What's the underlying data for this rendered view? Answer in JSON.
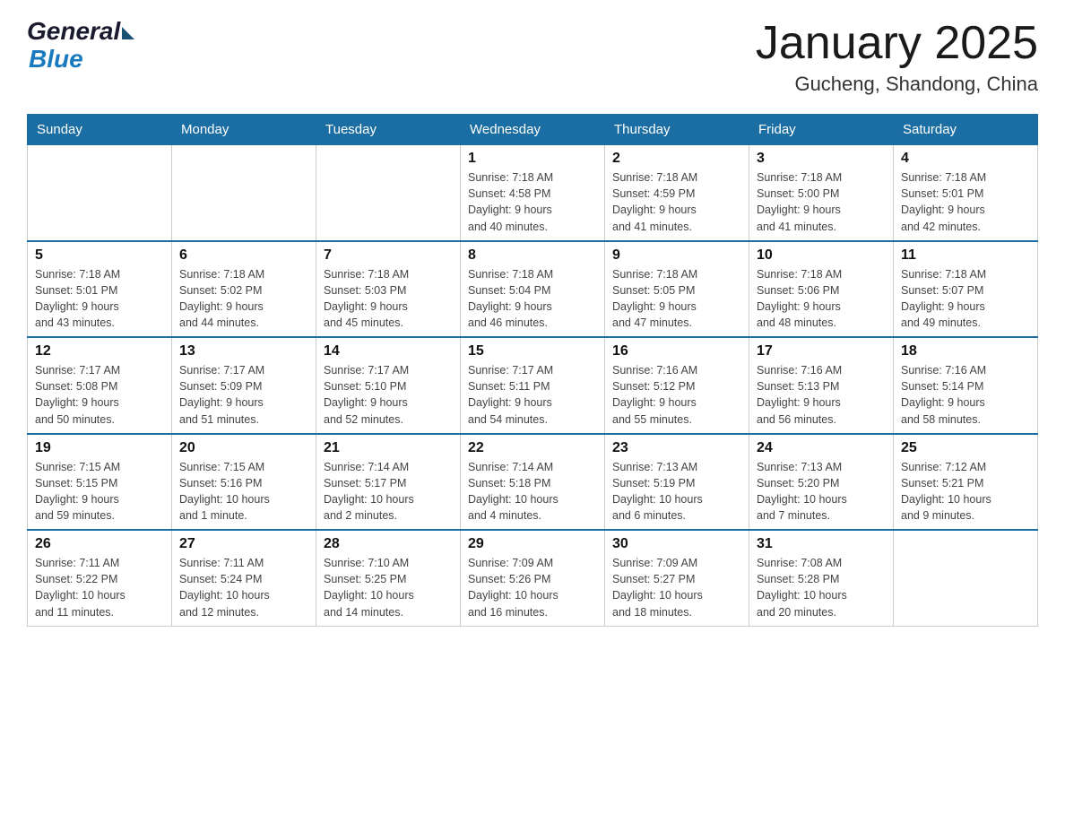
{
  "header": {
    "logo_general": "General",
    "logo_blue": "Blue",
    "month_title": "January 2025",
    "location": "Gucheng, Shandong, China"
  },
  "weekdays": [
    "Sunday",
    "Monday",
    "Tuesday",
    "Wednesday",
    "Thursday",
    "Friday",
    "Saturday"
  ],
  "weeks": [
    [
      {
        "day": "",
        "info": ""
      },
      {
        "day": "",
        "info": ""
      },
      {
        "day": "",
        "info": ""
      },
      {
        "day": "1",
        "info": "Sunrise: 7:18 AM\nSunset: 4:58 PM\nDaylight: 9 hours\nand 40 minutes."
      },
      {
        "day": "2",
        "info": "Sunrise: 7:18 AM\nSunset: 4:59 PM\nDaylight: 9 hours\nand 41 minutes."
      },
      {
        "day": "3",
        "info": "Sunrise: 7:18 AM\nSunset: 5:00 PM\nDaylight: 9 hours\nand 41 minutes."
      },
      {
        "day": "4",
        "info": "Sunrise: 7:18 AM\nSunset: 5:01 PM\nDaylight: 9 hours\nand 42 minutes."
      }
    ],
    [
      {
        "day": "5",
        "info": "Sunrise: 7:18 AM\nSunset: 5:01 PM\nDaylight: 9 hours\nand 43 minutes."
      },
      {
        "day": "6",
        "info": "Sunrise: 7:18 AM\nSunset: 5:02 PM\nDaylight: 9 hours\nand 44 minutes."
      },
      {
        "day": "7",
        "info": "Sunrise: 7:18 AM\nSunset: 5:03 PM\nDaylight: 9 hours\nand 45 minutes."
      },
      {
        "day": "8",
        "info": "Sunrise: 7:18 AM\nSunset: 5:04 PM\nDaylight: 9 hours\nand 46 minutes."
      },
      {
        "day": "9",
        "info": "Sunrise: 7:18 AM\nSunset: 5:05 PM\nDaylight: 9 hours\nand 47 minutes."
      },
      {
        "day": "10",
        "info": "Sunrise: 7:18 AM\nSunset: 5:06 PM\nDaylight: 9 hours\nand 48 minutes."
      },
      {
        "day": "11",
        "info": "Sunrise: 7:18 AM\nSunset: 5:07 PM\nDaylight: 9 hours\nand 49 minutes."
      }
    ],
    [
      {
        "day": "12",
        "info": "Sunrise: 7:17 AM\nSunset: 5:08 PM\nDaylight: 9 hours\nand 50 minutes."
      },
      {
        "day": "13",
        "info": "Sunrise: 7:17 AM\nSunset: 5:09 PM\nDaylight: 9 hours\nand 51 minutes."
      },
      {
        "day": "14",
        "info": "Sunrise: 7:17 AM\nSunset: 5:10 PM\nDaylight: 9 hours\nand 52 minutes."
      },
      {
        "day": "15",
        "info": "Sunrise: 7:17 AM\nSunset: 5:11 PM\nDaylight: 9 hours\nand 54 minutes."
      },
      {
        "day": "16",
        "info": "Sunrise: 7:16 AM\nSunset: 5:12 PM\nDaylight: 9 hours\nand 55 minutes."
      },
      {
        "day": "17",
        "info": "Sunrise: 7:16 AM\nSunset: 5:13 PM\nDaylight: 9 hours\nand 56 minutes."
      },
      {
        "day": "18",
        "info": "Sunrise: 7:16 AM\nSunset: 5:14 PM\nDaylight: 9 hours\nand 58 minutes."
      }
    ],
    [
      {
        "day": "19",
        "info": "Sunrise: 7:15 AM\nSunset: 5:15 PM\nDaylight: 9 hours\nand 59 minutes."
      },
      {
        "day": "20",
        "info": "Sunrise: 7:15 AM\nSunset: 5:16 PM\nDaylight: 10 hours\nand 1 minute."
      },
      {
        "day": "21",
        "info": "Sunrise: 7:14 AM\nSunset: 5:17 PM\nDaylight: 10 hours\nand 2 minutes."
      },
      {
        "day": "22",
        "info": "Sunrise: 7:14 AM\nSunset: 5:18 PM\nDaylight: 10 hours\nand 4 minutes."
      },
      {
        "day": "23",
        "info": "Sunrise: 7:13 AM\nSunset: 5:19 PM\nDaylight: 10 hours\nand 6 minutes."
      },
      {
        "day": "24",
        "info": "Sunrise: 7:13 AM\nSunset: 5:20 PM\nDaylight: 10 hours\nand 7 minutes."
      },
      {
        "day": "25",
        "info": "Sunrise: 7:12 AM\nSunset: 5:21 PM\nDaylight: 10 hours\nand 9 minutes."
      }
    ],
    [
      {
        "day": "26",
        "info": "Sunrise: 7:11 AM\nSunset: 5:22 PM\nDaylight: 10 hours\nand 11 minutes."
      },
      {
        "day": "27",
        "info": "Sunrise: 7:11 AM\nSunset: 5:24 PM\nDaylight: 10 hours\nand 12 minutes."
      },
      {
        "day": "28",
        "info": "Sunrise: 7:10 AM\nSunset: 5:25 PM\nDaylight: 10 hours\nand 14 minutes."
      },
      {
        "day": "29",
        "info": "Sunrise: 7:09 AM\nSunset: 5:26 PM\nDaylight: 10 hours\nand 16 minutes."
      },
      {
        "day": "30",
        "info": "Sunrise: 7:09 AM\nSunset: 5:27 PM\nDaylight: 10 hours\nand 18 minutes."
      },
      {
        "day": "31",
        "info": "Sunrise: 7:08 AM\nSunset: 5:28 PM\nDaylight: 10 hours\nand 20 minutes."
      },
      {
        "day": "",
        "info": ""
      }
    ]
  ]
}
